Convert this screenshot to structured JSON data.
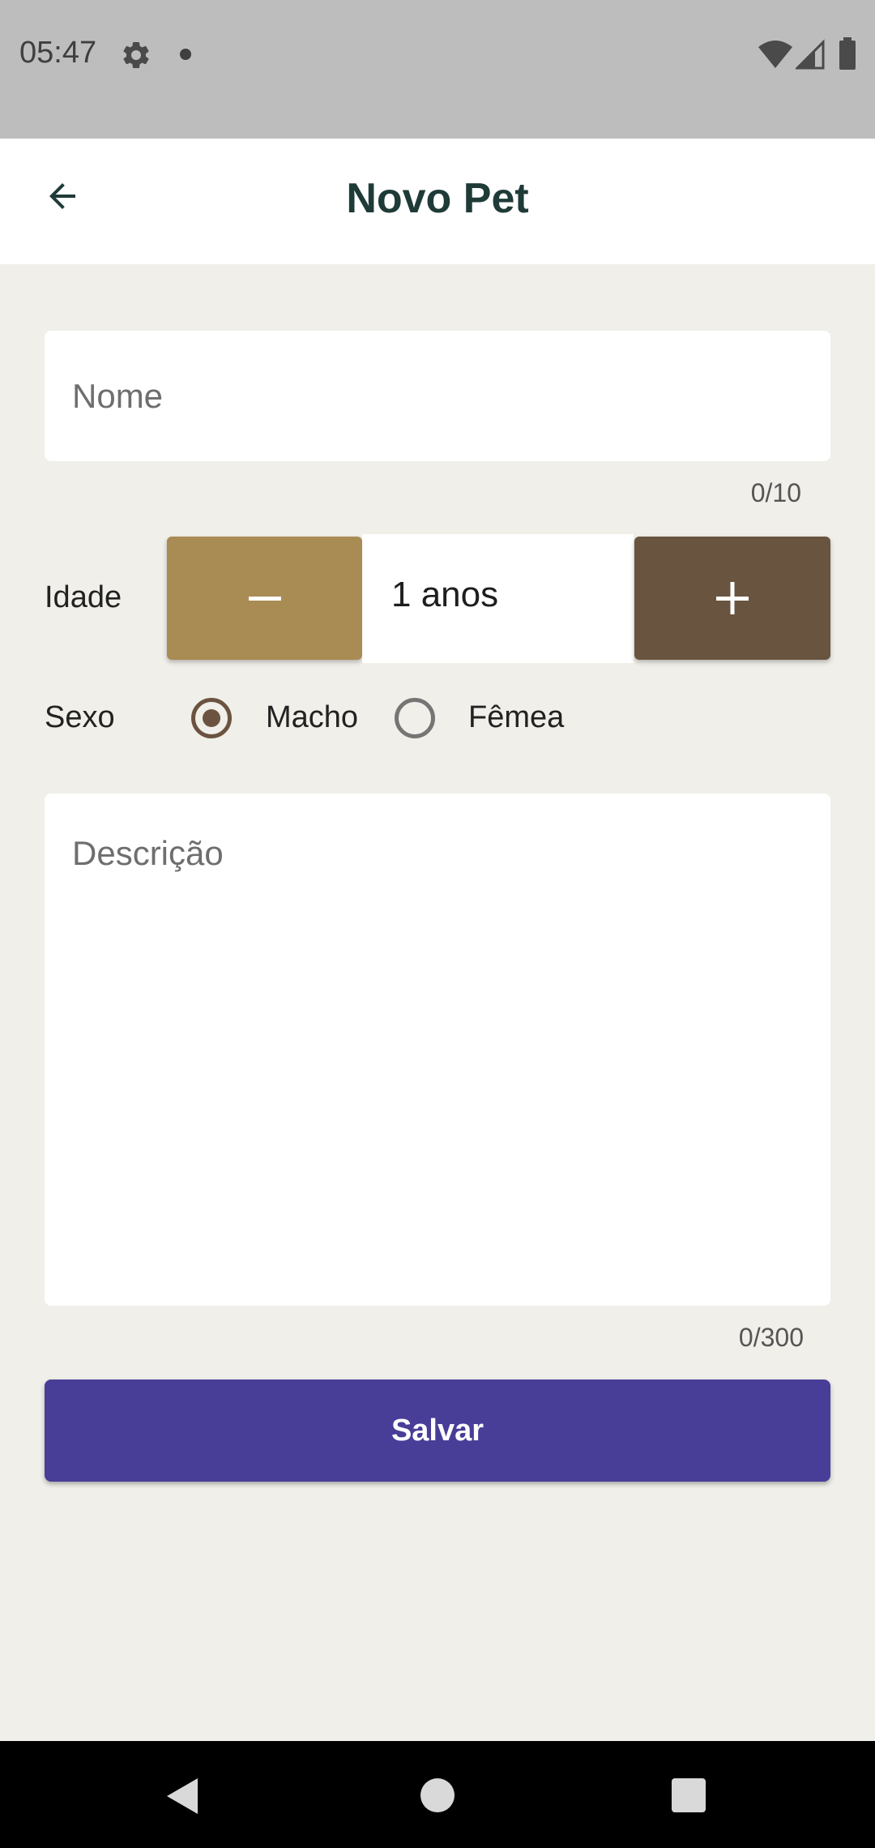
{
  "status_bar": {
    "time": "05:47",
    "icons": [
      "gear-icon",
      "notification-dot-icon",
      "wifi-icon",
      "signal-icon",
      "battery-icon"
    ]
  },
  "app_bar": {
    "title": "Novo Pet",
    "back_icon": "arrow-left-icon"
  },
  "form": {
    "name": {
      "placeholder": "Nome",
      "value": "",
      "counter": "0/10"
    },
    "age": {
      "label": "Idade",
      "value": "1 anos",
      "decrement_icon": "minus-icon",
      "increment_icon": "plus-icon"
    },
    "sex": {
      "label": "Sexo",
      "options": [
        "Macho",
        "Fêmea"
      ],
      "selected": "Macho"
    },
    "description": {
      "placeholder": "Descrição",
      "value": "",
      "counter": "0/300"
    },
    "save_label": "Salvar"
  },
  "nav_bar": {
    "icons": [
      "nav-back-icon",
      "nav-home-icon",
      "nav-recents-icon"
    ]
  },
  "colors": {
    "status_bar": "#bdbdbd",
    "background": "#f0efe9",
    "title_text": "#1f3b38",
    "minus_button": "#a98b54",
    "plus_button": "#695440",
    "radio_selected": "#6b5340",
    "save_button": "#483d97",
    "nav_bar": "#000000"
  }
}
